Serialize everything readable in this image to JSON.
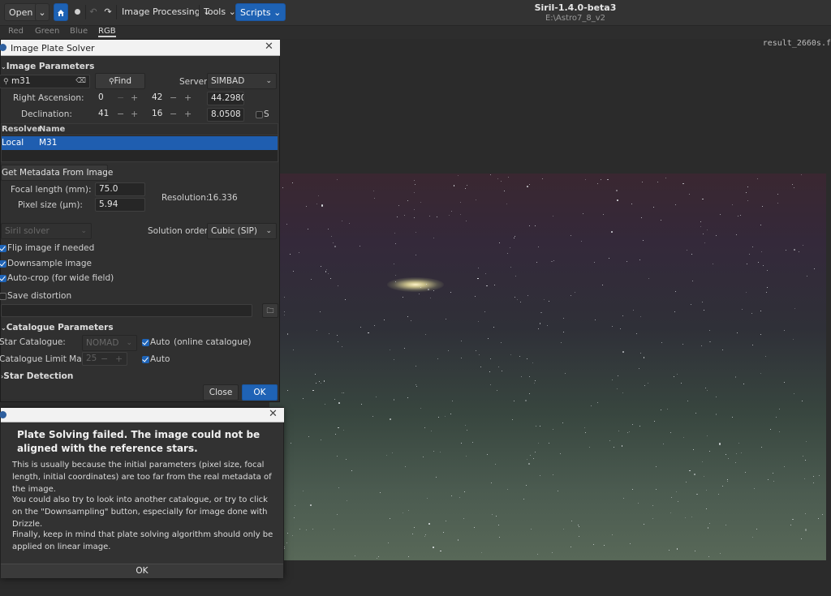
{
  "window": {
    "title": "Siril-1.4.0-beta3",
    "subtitle": "E:\\Astro7_8_v2"
  },
  "toolbar": {
    "open_label": "Open",
    "image_processing_label": "Image Processing",
    "tools_label": "Tools",
    "scripts_label": "Scripts"
  },
  "channels": [
    "Red",
    "Green",
    "Blue",
    "RGB"
  ],
  "active_channel": "RGB",
  "image_name": "result_2660s.f",
  "plate_solver": {
    "title": "Image Plate Solver",
    "image_params_label": "Image Parameters",
    "search_value": "m31",
    "find_label": "Find",
    "server_label": "Server:",
    "server_value": "SIMBAD",
    "ra_label": "Right Ascension:",
    "ra_h": "0",
    "ra_m": "42",
    "ra_s": "44.2980",
    "dec_label": "Declination:",
    "dec_d": "41",
    "dec_m": "16",
    "dec_s": "8.0508",
    "south_label": "S",
    "table_headers": [
      "Resolver",
      "Name"
    ],
    "table_rows": [
      [
        "Local",
        "M31"
      ]
    ],
    "get_metadata_label": "Get Metadata From Image",
    "focal_label": "Focal length (mm):",
    "focal_value": "75.0",
    "pixel_label": "Pixel size (µm):",
    "pixel_value": "5.94",
    "resolution_label": "Resolution:",
    "resolution_value": "16.336",
    "solver_value": "Siril solver",
    "solution_order_label": "Solution order:",
    "solution_order_value": "Cubic (SIP)",
    "flip_label": "Flip image if needed",
    "downsample_label": "Downsample image",
    "autocrop_label": "Auto-crop (for wide field)",
    "save_distortion_label": "Save distortion",
    "catalogue_params_label": "Catalogue Parameters",
    "star_catalogue_label": "Star Catalogue:",
    "star_catalogue_value": "NOMAD",
    "auto_label": "Auto",
    "online_catalogue_label": "(online catalogue)",
    "limit_mag_label": "Catalogue Limit Mag:",
    "limit_mag_value": "25",
    "auto_label_2": "Auto",
    "star_detection_label": "Star Detection",
    "close_label": "Close",
    "ok_label": "OK"
  },
  "error_dialog": {
    "heading": "Plate Solving failed. The image could not be aligned with the reference stars.",
    "p1": "This is usually because the initial parameters (pixel size, focal length, initial coordinates) are too far from the real metadata of the image.",
    "p2": "You could also try to look into another catalogue, or try to click on the \"Downsampling\" button, especially for image done with Drizzle.",
    "p3": "Finally, keep in mind that plate solving algorithm should only be applied on linear image.",
    "ok_label": "OK"
  }
}
